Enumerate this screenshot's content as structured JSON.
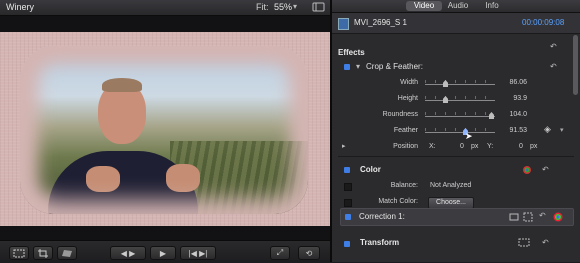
{
  "viewer": {
    "title": "Winery",
    "fit_label": "Fit:",
    "fit_value": "55%"
  },
  "inspector": {
    "tabs": [
      {
        "label": "Video",
        "active": true
      },
      {
        "label": "Audio",
        "active": false
      },
      {
        "label": "Info",
        "active": false
      }
    ],
    "clip_name": "MVI_2696_S 1",
    "clip_time": "00:00:09:08",
    "effects_title": "Effects",
    "crop_feather": {
      "title": "Crop & Feather:",
      "params": [
        {
          "label": "Width",
          "value": "86.06",
          "level": 0.3
        },
        {
          "label": "Height",
          "value": "93.9",
          "level": 0.3
        },
        {
          "label": "Roundness",
          "value": "104.0",
          "level": 0.95
        },
        {
          "label": "Feather",
          "value": "91.53",
          "level": 0.6
        }
      ],
      "position": {
        "label": "Position",
        "x_label": "X:",
        "x_value": "0",
        "x_unit": "px",
        "y_label": "Y:",
        "y_value": "0",
        "y_unit": "px"
      }
    },
    "color": {
      "title": "Color",
      "balance_label": "Balance:",
      "balance_value": "Not Analyzed",
      "match_label": "Match Color:",
      "choose_label": "Choose..."
    },
    "correction_title": "Correction 1:",
    "transform_title": "Transform"
  },
  "colors": {
    "accent_blue": "#3f7ee6",
    "timecode_blue": "#5aa1ff",
    "frame_background": "#d4b5b3"
  }
}
